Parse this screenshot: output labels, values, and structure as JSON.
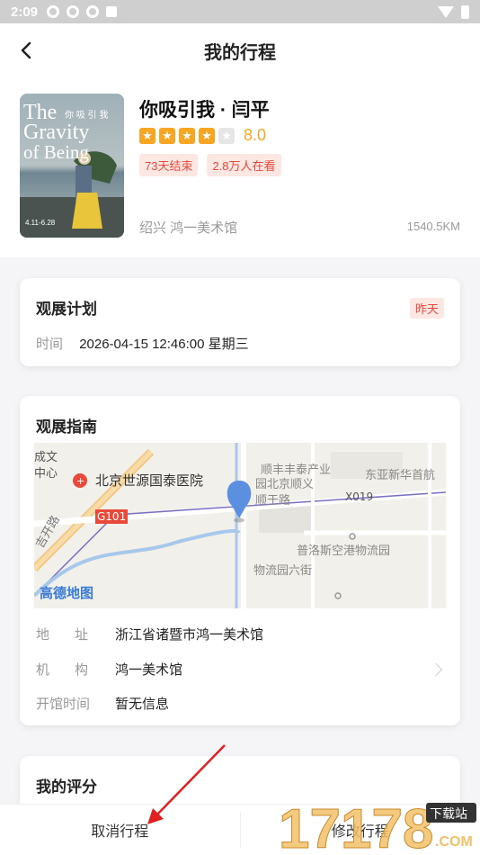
{
  "status": {
    "time": "2:09"
  },
  "header": {
    "title": "我的行程"
  },
  "exhibit": {
    "name": "你吸引我 · 闫平",
    "rating": 4,
    "rating_max": 5,
    "score": "8.0",
    "tags": [
      "73天结束",
      "2.8万人在看"
    ],
    "location": "绍兴  鸿一美术馆",
    "distance": "1540.5KM",
    "poster": {
      "title_line1": "The",
      "title_line2": "Gravity",
      "title_line3": "of Being",
      "cn": "你 吸 引 我",
      "dates": "4.11-6.28"
    }
  },
  "plan": {
    "title": "观展计划",
    "badge": "昨天",
    "time_label": "时间",
    "time_value": "2026-04-15 12:46:00  星期三"
  },
  "guide": {
    "title": "观展指南",
    "map_labels": {
      "hospital": "北京世源国泰医院",
      "road_g101": "G101",
      "road_x019": "X019",
      "shunfeng": "顺丰丰泰产业",
      "shunyi": "园北京顺义",
      "shunyu": "顺于路",
      "dongya": "东亚新华首航",
      "puluosi": "普洛斯空港物流园",
      "wuliu": "物流园六街",
      "chengwen": "成文",
      "zhongxin": "中心",
      "jinan": "吉开路",
      "amap": "高德地图"
    },
    "address_label": "地址",
    "address_value": "浙江省诸暨市鸿一美术馆",
    "org_label": "机构",
    "org_value": "鸿一美术馆",
    "hours_label": "开馆时间",
    "hours_value": "暂无信息"
  },
  "review": {
    "title": "我的评分"
  },
  "bottom": {
    "cancel": "取消行程",
    "modify": "修改行程"
  },
  "watermark": {
    "text": "17178",
    "sub": "下载站",
    "com": ".COM"
  }
}
